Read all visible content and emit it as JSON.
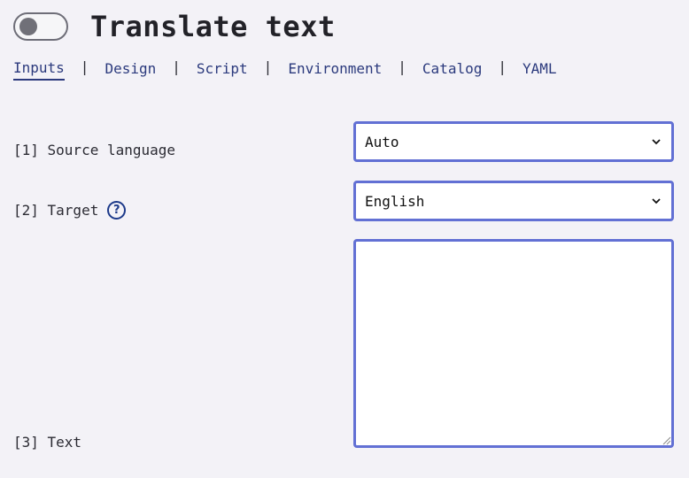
{
  "header": {
    "toggle": {
      "state": "off"
    },
    "title": "Translate text"
  },
  "tabs": [
    {
      "label": "Inputs",
      "active": true
    },
    {
      "label": "Design"
    },
    {
      "label": "Script"
    },
    {
      "label": "Environment"
    },
    {
      "label": "Catalog"
    },
    {
      "label": "YAML"
    }
  ],
  "separator": "|",
  "fields": {
    "source_language": {
      "label": "[1] Source language",
      "value": "Auto"
    },
    "target": {
      "label": "[2] Target",
      "value": "English",
      "help_icon": "?"
    },
    "text": {
      "label": "[3] Text",
      "value": ""
    }
  },
  "colors": {
    "background": "#f3f2f7",
    "accent_border": "#6270d4",
    "link": "#2b3a7d"
  }
}
